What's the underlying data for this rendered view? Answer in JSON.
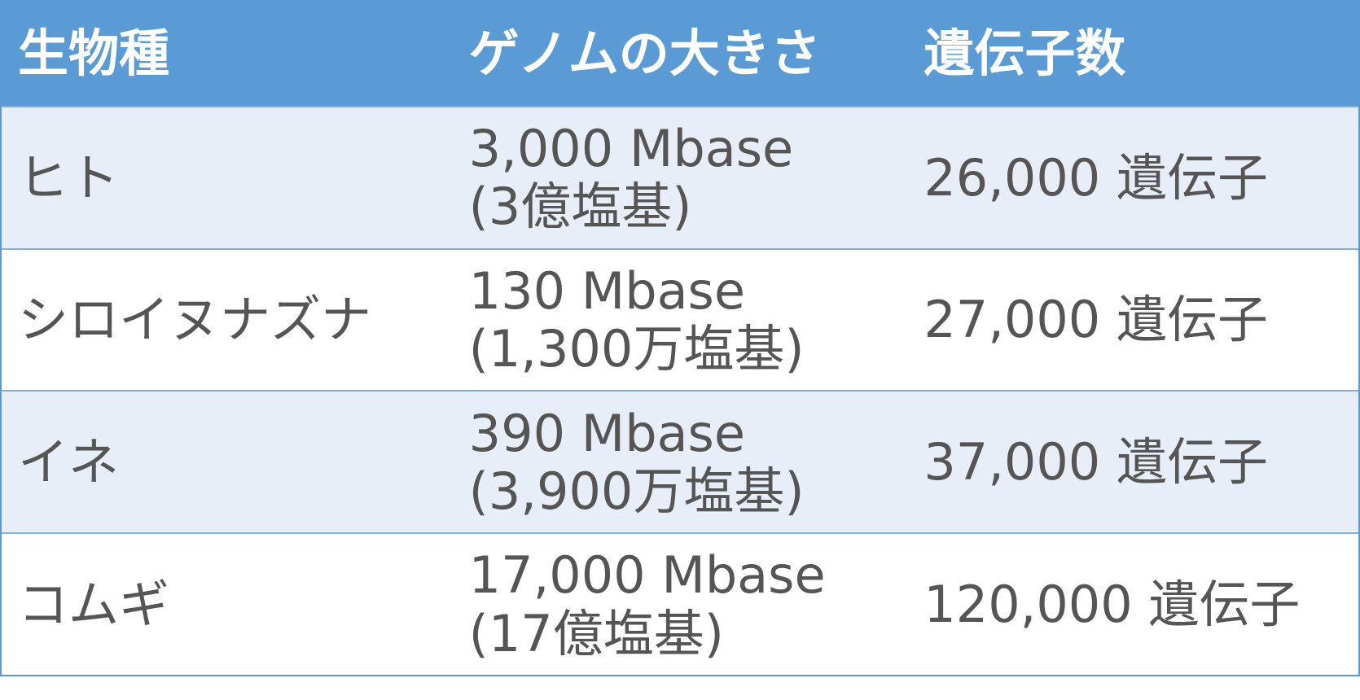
{
  "table": {
    "headers": [
      "生物種",
      "ゲノムの大きさ",
      "遺伝子数"
    ],
    "rows": [
      {
        "species": "ヒト",
        "genome_line1": "3,000 Mbase",
        "genome_line2": "(3億塩基)",
        "genes": "26,000 遺伝子"
      },
      {
        "species": "シロイヌナズナ",
        "genome_line1": "130 Mbase",
        "genome_line2": "(1,300万塩基)",
        "genes": "27,000 遺伝子"
      },
      {
        "species": "イネ",
        "genome_line1": "390 Mbase",
        "genome_line2": "(3,900万塩基)",
        "genes": "37,000 遺伝子"
      },
      {
        "species": "コムギ",
        "genome_line1": "17,000 Mbase",
        "genome_line2": "(17億塩基)",
        "genes": "120,000 遺伝子"
      }
    ]
  },
  "colors": {
    "header_bg": "#5b9bd5",
    "header_text": "#ffffff",
    "odd_row_bg": "#e8eef7",
    "even_row_bg": "#ffffff",
    "body_text": "#555555",
    "border": "#5b9bd5"
  }
}
